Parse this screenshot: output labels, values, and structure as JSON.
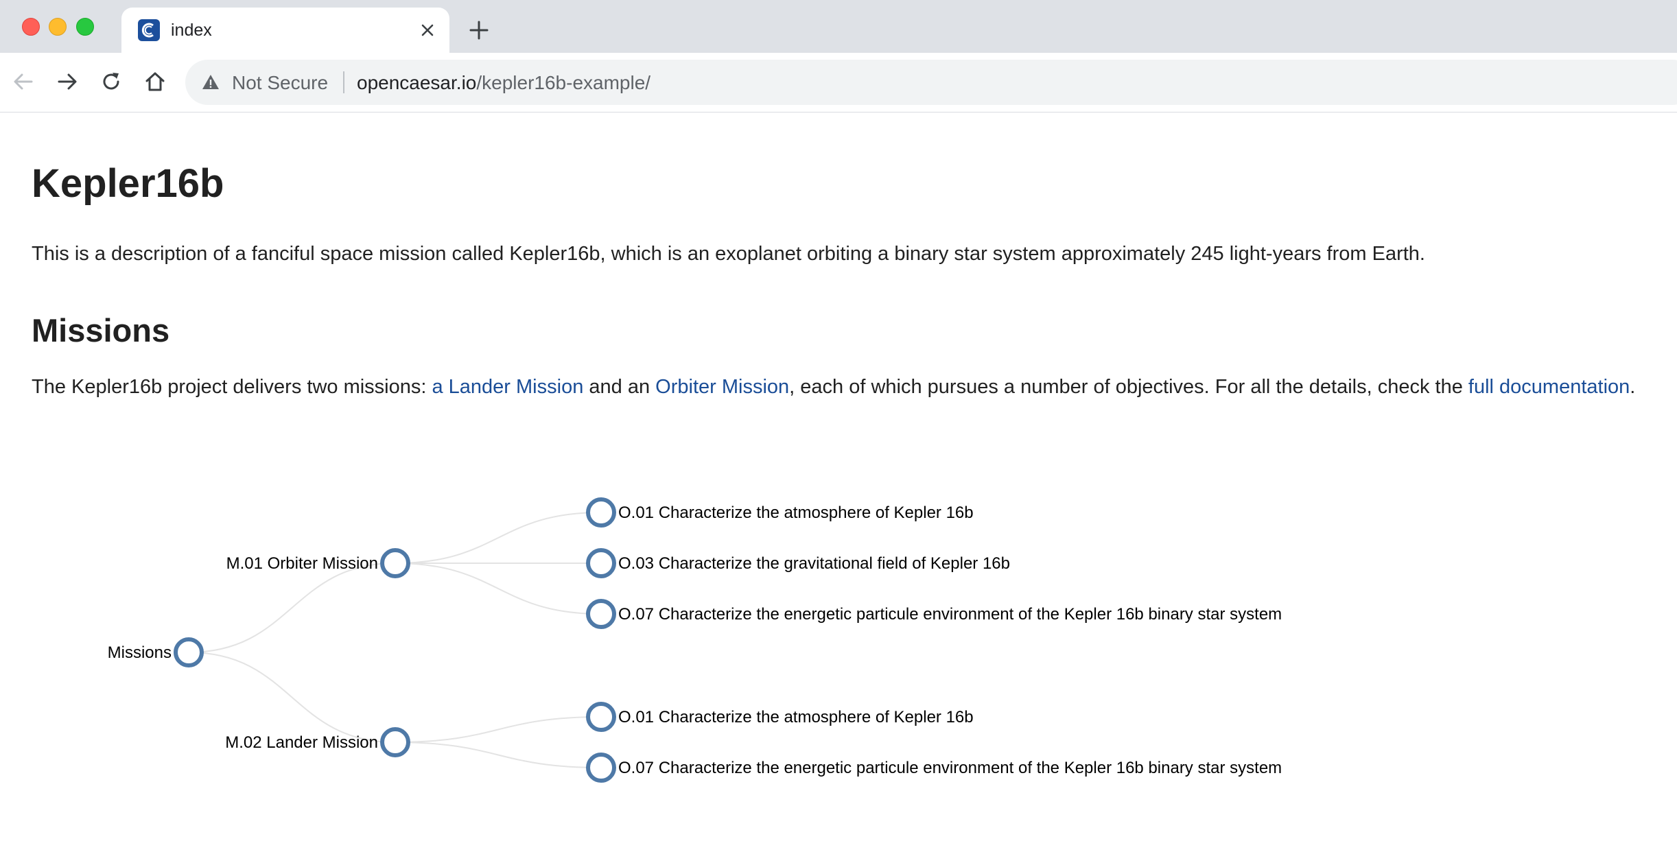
{
  "browser": {
    "tab_title": "index",
    "security_label": "Not Secure",
    "url_host": "opencaesar.io",
    "url_path": "/kepler16b-example/"
  },
  "page": {
    "title": "Kepler16b",
    "description": "This is a description of a fanciful space mission called Kepler16b, which is an exoplanet orbiting a binary star system approximately 245 light-years from Earth.",
    "missions_heading": "Missions",
    "missions_text_1": "The Kepler16b project delivers two missions: ",
    "lander_link": "a Lander Mission",
    "missions_text_2": " and an ",
    "orbiter_link": "Orbiter Mission",
    "missions_text_3": ", each of which pursues a number of objectives. For all the details, check the ",
    "docs_link": "full documentation",
    "missions_text_4": ".",
    "link_color": "#1a4d97"
  },
  "tree": {
    "root": "Missions",
    "node_color": "#4e79a7",
    "missions": [
      {
        "label": "M.01 Orbiter Mission",
        "objectives": [
          "O.01 Characterize the atmosphere of Kepler 16b",
          "O.03 Characterize the gravitational field of Kepler 16b",
          "O.07 Characterize the energetic particule environment of the Kepler 16b binary star system"
        ]
      },
      {
        "label": "M.02 Lander Mission",
        "objectives": [
          "O.01 Characterize the atmosphere of Kepler 16b",
          "O.07 Characterize the energetic particule environment of the Kepler 16b binary star system"
        ]
      }
    ]
  }
}
